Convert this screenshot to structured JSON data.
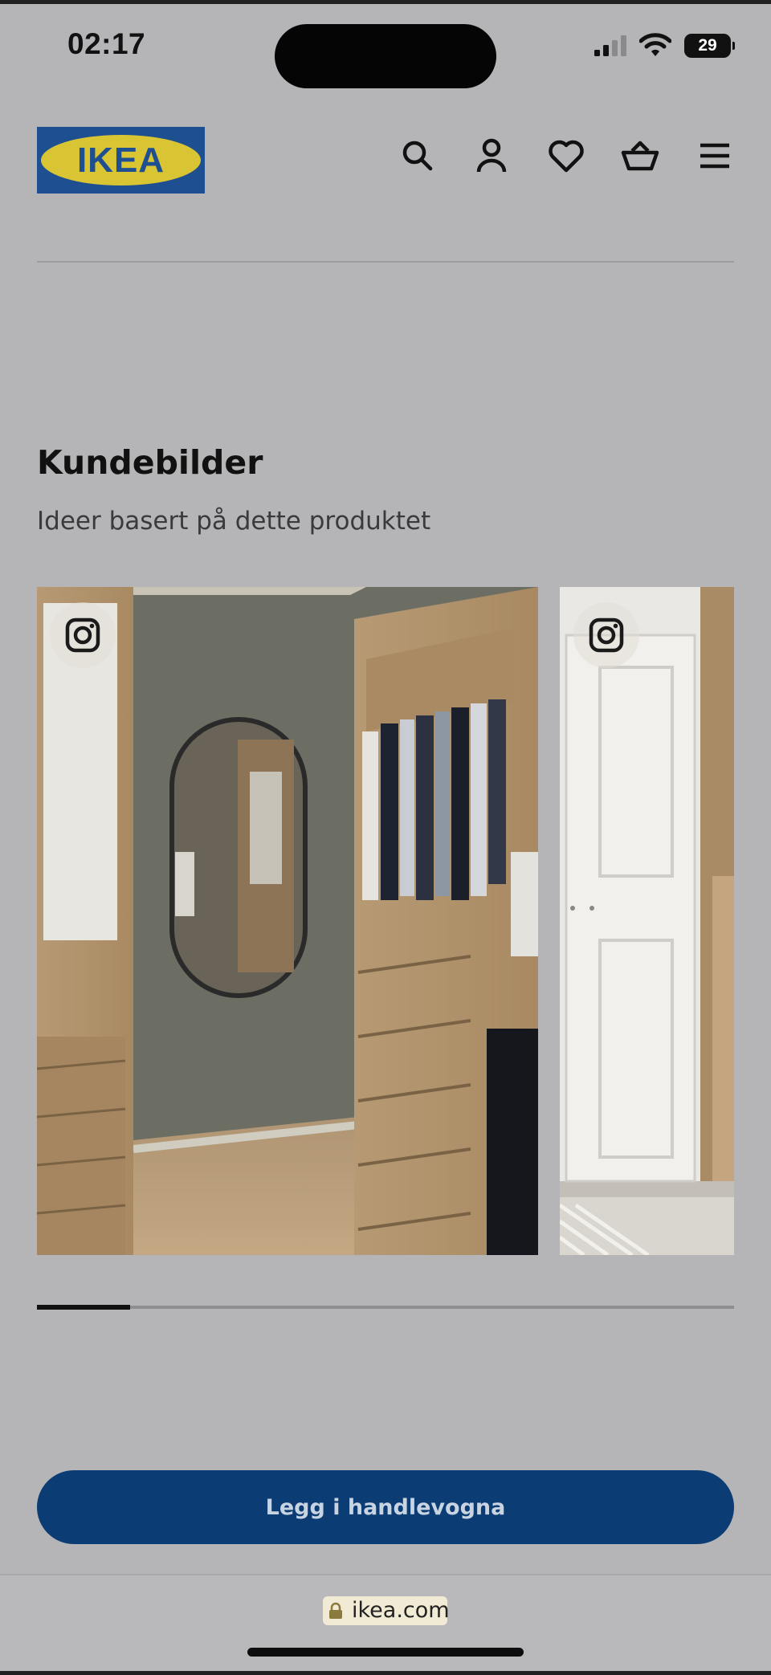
{
  "status_bar": {
    "time": "02:17",
    "battery": "29"
  },
  "header": {
    "logo_text": "IKEA",
    "icons": [
      "search-icon",
      "account-icon",
      "heart-icon",
      "basket-icon",
      "menu-icon"
    ]
  },
  "section": {
    "title": "Kundebilder",
    "subtitle": "Ideer basert på dette produktet"
  },
  "gallery": {
    "slides": [
      {
        "badge_icon": "instagram-icon"
      },
      {
        "badge_icon": "instagram-icon"
      }
    ],
    "scroll_progress": 0.134
  },
  "cta": {
    "label": "Legg i handlevogna"
  },
  "browser": {
    "url": "ikea.com"
  },
  "colors": {
    "background": "#b5b5b7",
    "cta": "#0c3c74",
    "logo_blue": "#1d4f91",
    "logo_yellow": "#d9c533"
  }
}
